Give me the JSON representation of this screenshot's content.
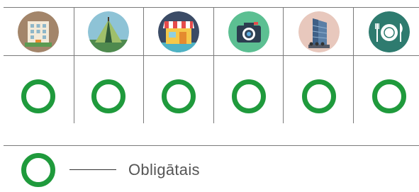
{
  "columns": [
    {
      "icon": "apartment-building-icon",
      "bg": "#a3856a"
    },
    {
      "icon": "tent-icon",
      "bg": "#8ec3d6"
    },
    {
      "icon": "shop-store-icon",
      "bg": "#3b4b66"
    },
    {
      "icon": "camera-icon",
      "bg": "#5cbf92"
    },
    {
      "icon": "office-tower-icon",
      "bg": "#e8c8bd"
    },
    {
      "icon": "restaurant-plate-icon",
      "bg": "#2e7b6f"
    }
  ],
  "marks": [
    "O",
    "O",
    "O",
    "O",
    "O",
    "O"
  ],
  "legend": {
    "symbol": "O",
    "label": "Obligātais",
    "mark_color": "#1f9a3c"
  }
}
